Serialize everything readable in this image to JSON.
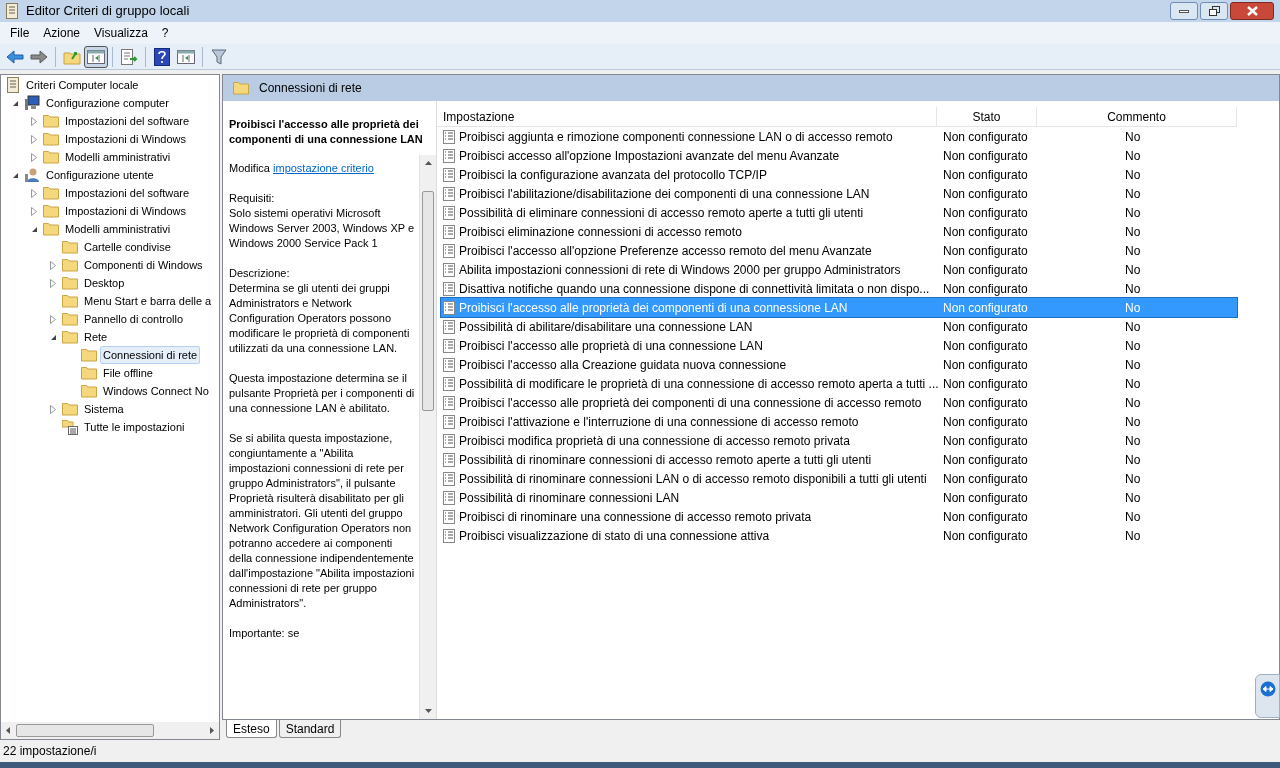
{
  "window": {
    "title": "Editor Criteri di gruppo locali"
  },
  "menu": [
    {
      "label": "File"
    },
    {
      "label": "Azione"
    },
    {
      "label": "Visualizza"
    },
    {
      "label": "?"
    }
  ],
  "toolbar": [
    {
      "kind": "back"
    },
    {
      "kind": "forward"
    },
    {
      "kind": "sep"
    },
    {
      "kind": "up"
    },
    {
      "kind": "pane",
      "pressed": true
    },
    {
      "kind": "sep"
    },
    {
      "kind": "export"
    },
    {
      "kind": "sep"
    },
    {
      "kind": "help"
    },
    {
      "kind": "pane2"
    },
    {
      "kind": "sep"
    },
    {
      "kind": "filter"
    }
  ],
  "tree": [
    {
      "label": "Criteri Computer locale",
      "kind": "policy",
      "selected": false,
      "children": [
        {
          "label": "Configurazione computer",
          "kind": "computer",
          "expanded": true,
          "selected": false,
          "children": [
            {
              "label": "Impostazioni del software",
              "kind": "folder",
              "expanded": false,
              "selected": false
            },
            {
              "label": "Impostazioni di Windows",
              "kind": "folder",
              "expanded": false,
              "selected": false
            },
            {
              "label": "Modelli amministrativi",
              "kind": "folder",
              "expanded": false,
              "selected": false
            }
          ]
        },
        {
          "label": "Configurazione utente",
          "kind": "user",
          "expanded": true,
          "selected": false,
          "children": [
            {
              "label": "Impostazioni del software",
              "kind": "folder",
              "expanded": false,
              "selected": false
            },
            {
              "label": "Impostazioni di Windows",
              "kind": "folder",
              "expanded": false,
              "selected": false
            },
            {
              "label": "Modelli amministrativi",
              "kind": "folder",
              "expanded": true,
              "selected": false,
              "children": [
                {
                  "label": "Cartelle condivise",
                  "kind": "folder",
                  "selected": false
                },
                {
                  "label": "Componenti di Windows",
                  "kind": "folder",
                  "expanded": false,
                  "selected": false
                },
                {
                  "label": "Desktop",
                  "kind": "folder",
                  "expanded": false,
                  "selected": false
                },
                {
                  "label": "Menu Start e barra delle a",
                  "kind": "folder",
                  "selected": false
                },
                {
                  "label": "Pannello di controllo",
                  "kind": "folder",
                  "expanded": false,
                  "selected": false
                },
                {
                  "label": "Rete",
                  "kind": "folder",
                  "expanded": true,
                  "selected": false,
                  "children": [
                    {
                      "label": "Connessioni di rete",
                      "kind": "folder",
                      "selected": true
                    },
                    {
                      "label": "File offline",
                      "kind": "folder",
                      "selected": false
                    },
                    {
                      "label": "Windows Connect No",
                      "kind": "folder",
                      "selected": false
                    }
                  ]
                },
                {
                  "label": "Sistema",
                  "kind": "folder",
                  "expanded": false,
                  "selected": false
                },
                {
                  "label": "Tutte le impostazioni",
                  "kind": "all-settings",
                  "selected": false
                }
              ]
            }
          ]
        }
      ]
    }
  ],
  "header": {
    "title": "Connessioni di rete"
  },
  "description": {
    "title": "Proibisci l'accesso alle proprietà dei componenti di una connessione LAN",
    "edit_prefix": "Modifica",
    "edit_link": "impostazione criterio",
    "paragraphs": [
      [
        "Requisiti:",
        "Solo sistemi operativi Microsoft Windows Server 2003, Windows XP e Windows 2000 Service Pack 1"
      ],
      [
        "Descrizione:",
        "Determina se gli utenti dei gruppi Administrators e Network Configuration Operators possono modificare le proprietà di componenti utilizzati da una connessione LAN."
      ],
      [
        "Questa impostazione determina se il pulsante Proprietà per i componenti di una connessione LAN è abilitato."
      ],
      [
        "Se si abilita questa impostazione, congiuntamente a \"Abilita impostazioni connessioni di rete per gruppo Administrators\", il pulsante Proprietà risulterà disabilitato per gli amministratori. Gli utenti del gruppo Network Configuration Operators non potranno accedere ai componenti della connessione indipendentemente dall'impostazione \"Abilita impostazioni connessioni di rete per gruppo Administrators\"."
      ],
      [
        "Importante: se"
      ]
    ]
  },
  "table": {
    "columns": [
      "Impostazione",
      "Stato",
      "Commento"
    ],
    "rows": [
      {
        "name": "Proibisci aggiunta e rimozione componenti connessione LAN o di accesso remoto",
        "state": "Non configurato",
        "comment": "No",
        "selected": false
      },
      {
        "name": "Proibisci accesso all'opzione Impostazioni avanzate del menu Avanzate",
        "state": "Non configurato",
        "comment": "No",
        "selected": false
      },
      {
        "name": "Proibisci la configurazione avanzata del protocollo TCP/IP",
        "state": "Non configurato",
        "comment": "No",
        "selected": false
      },
      {
        "name": "Proibisci l'abilitazione/disabilitazione dei componenti di una connessione LAN",
        "state": "Non configurato",
        "comment": "No",
        "selected": false
      },
      {
        "name": "Possibilità di eliminare connessioni di accesso remoto aperte a tutti gli utenti",
        "state": "Non configurato",
        "comment": "No",
        "selected": false
      },
      {
        "name": "Proibisci eliminazione connessioni di accesso remoto",
        "state": "Non configurato",
        "comment": "No",
        "selected": false
      },
      {
        "name": "Proibisci l'accesso all'opzione Preferenze accesso remoto del menu Avanzate",
        "state": "Non configurato",
        "comment": "No",
        "selected": false
      },
      {
        "name": "Abilita impostazioni connessioni di rete di Windows 2000 per gruppo Administrators",
        "state": "Non configurato",
        "comment": "No",
        "selected": false
      },
      {
        "name": "Disattiva notifiche quando una connessione dispone di connettività limitata o non dispo...",
        "state": "Non configurato",
        "comment": "No",
        "selected": false
      },
      {
        "name": "Proibisci l'accesso alle proprietà dei componenti di una connessione LAN",
        "state": "Non configurato",
        "comment": "No",
        "selected": true
      },
      {
        "name": "Possibilità di abilitare/disabilitare una connessione LAN",
        "state": "Non configurato",
        "comment": "No",
        "selected": false
      },
      {
        "name": "Proibisci l'accesso alle proprietà di una connessione LAN",
        "state": "Non configurato",
        "comment": "No",
        "selected": false
      },
      {
        "name": "Proibisci l'accesso alla Creazione guidata nuova connessione",
        "state": "Non configurato",
        "comment": "No",
        "selected": false
      },
      {
        "name": "Possibilità di modificare le proprietà di una connessione di accesso remoto aperta a tutti ...",
        "state": "Non configurato",
        "comment": "No",
        "selected": false
      },
      {
        "name": "Proibisci l'accesso alle proprietà dei componenti di una connessione di accesso remoto",
        "state": "Non configurato",
        "comment": "No",
        "selected": false
      },
      {
        "name": "Proibisci l'attivazione e l'interruzione di una connessione di accesso remoto",
        "state": "Non configurato",
        "comment": "No",
        "selected": false
      },
      {
        "name": "Proibisci modifica proprietà di una connessione di accesso remoto privata",
        "state": "Non configurato",
        "comment": "No",
        "selected": false
      },
      {
        "name": "Possibilità di rinominare connessioni di accesso remoto aperte a tutti gli utenti",
        "state": "Non configurato",
        "comment": "No",
        "selected": false
      },
      {
        "name": "Possibilità di rinominare connessioni LAN o di accesso remoto disponibili a tutti gli utenti",
        "state": "Non configurato",
        "comment": "No",
        "selected": false
      },
      {
        "name": "Possibilità di rinominare connessioni LAN",
        "state": "Non configurato",
        "comment": "No",
        "selected": false
      },
      {
        "name": "Proibisci di rinominare una connessione di accesso remoto privata",
        "state": "Non configurato",
        "comment": "No",
        "selected": false
      },
      {
        "name": "Proibisci visualizzazione di stato di una connessione attiva",
        "state": "Non configurato",
        "comment": "No",
        "selected": false
      }
    ]
  },
  "view_tabs": [
    {
      "label": "Esteso",
      "selected": true
    },
    {
      "label": "Standard",
      "selected": false
    }
  ],
  "status_bar": {
    "text": "22 impostazione/i"
  }
}
